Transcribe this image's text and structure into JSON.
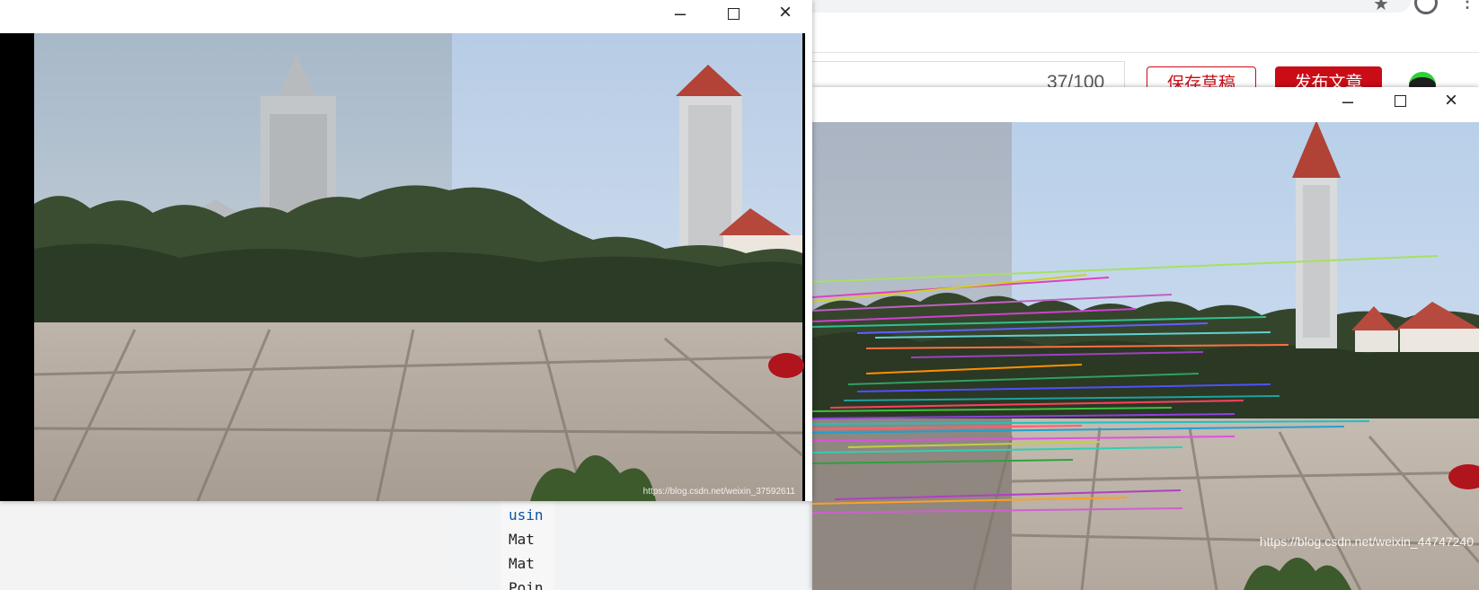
{
  "browser": {
    "icons": [
      "star-icon",
      "account-icon",
      "more-menu-icon"
    ]
  },
  "editor": {
    "word_count": "37/100",
    "save_draft_label": "保存草稿",
    "publish_label": "发布文章",
    "colors": {
      "brand_red": "#ca0c16",
      "avatar_green": "#2fcf3a"
    }
  },
  "code": {
    "lines": [
      {
        "text": "usin",
        "kind": "keyword"
      },
      {
        "text": "Mat",
        "kind": "plain"
      },
      {
        "text": "Mat",
        "kind": "plain"
      },
      {
        "text": "Poin",
        "kind": "plain"
      }
    ]
  },
  "panorama_window": {
    "controls": {
      "minimize": "minimize-icon",
      "maximize": "maximize-icon",
      "close": "close-icon"
    },
    "watermark": "https://blog.csdn.net/weixin_37592611"
  },
  "matches_window": {
    "controls": {
      "minimize": "minimize-icon",
      "maximize": "maximize-icon",
      "close": "close-icon"
    },
    "watermark": "https://blog.csdn.net/weixin_44747240"
  }
}
